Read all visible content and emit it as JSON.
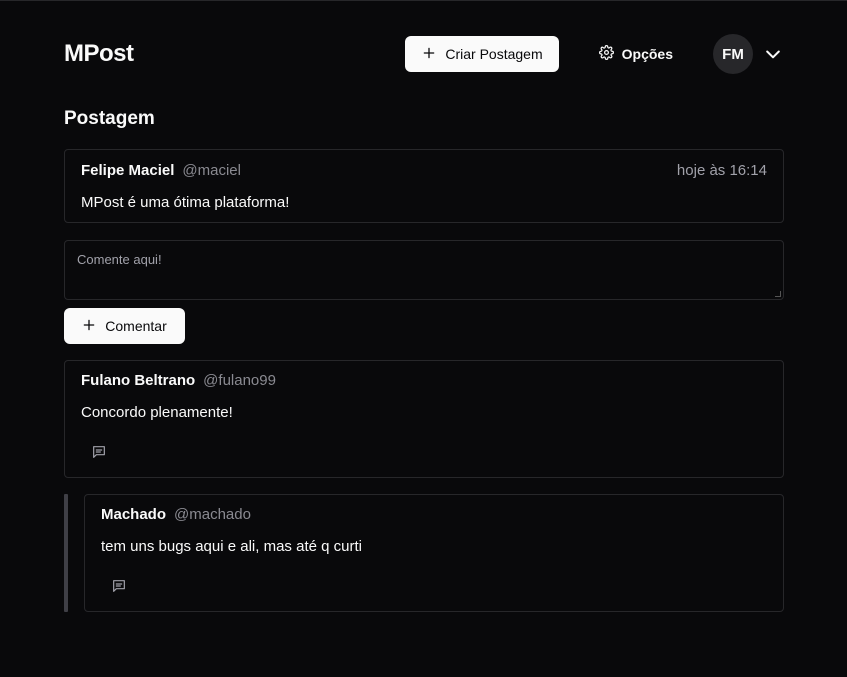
{
  "header": {
    "brand": "MPost",
    "create_label": "Criar Postagem",
    "options_label": "Opções",
    "avatar_initials": "FM"
  },
  "section_title": "Postagem",
  "post": {
    "author": "Felipe Maciel",
    "handle": "@maciel",
    "time": "hoje às 16:14",
    "text": "MPost é uma ótima plataforma!"
  },
  "comment_input": {
    "placeholder": "Comente aqui!",
    "value": ""
  },
  "comment_button_label": "Comentar",
  "comments": [
    {
      "author": "Fulano Beltrano",
      "handle": "@fulano99",
      "text": "Concordo plenamente!"
    },
    {
      "author": "Machado",
      "handle": "@machado",
      "text": "tem uns bugs aqui e ali, mas até q curti"
    }
  ],
  "icons": {
    "plus": "plus-icon",
    "settings": "gear-icon",
    "chevron": "chevron-down-icon",
    "reply": "message-square-icon"
  }
}
